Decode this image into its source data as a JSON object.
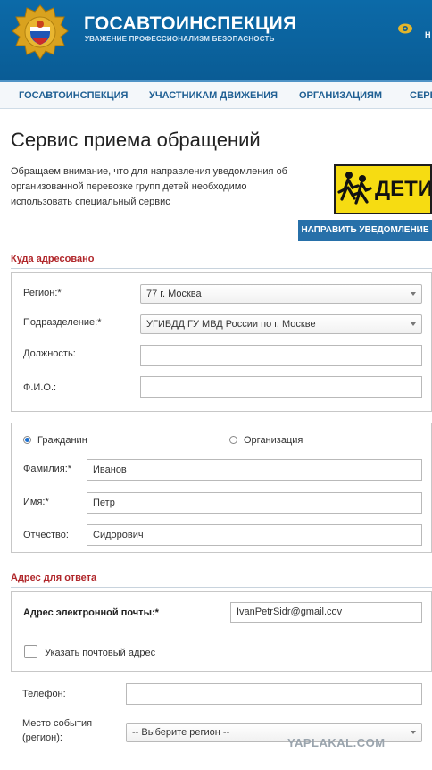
{
  "header": {
    "title": "ГОСАВТОИНСПЕКЦИЯ",
    "subtitle": "УВАЖЕНИЕ ПРОФЕССИОНАЛИЗМ БЕЗОПАСНОСТЬ",
    "cut_text": "Н"
  },
  "nav": {
    "items": [
      "ГОСАВТОИНСПЕКЦИЯ",
      "УЧАСТНИКАМ ДВИЖЕНИЯ",
      "ОРГАНИЗАЦИЯМ",
      "СЕРВ"
    ]
  },
  "page": {
    "title": "Сервис приема обращений",
    "notice": "Обращаем внимание, что для направления уведомления об организованной перевозке групп детей необходимо использовать специальный сервис",
    "banner_text": "ДЕТИ",
    "send_button": "НАПРАВИТЬ УВЕДОМЛЕНИЕ"
  },
  "addressed": {
    "title": "Куда адресовано",
    "region_label": "Регион:*",
    "region_value": "77 г. Москва",
    "division_label": "Подразделение:*",
    "division_value": "УГИБДД ГУ МВД России по г. Москве",
    "position_label": "Должность:",
    "position_value": "",
    "fio_label": "Ф.И.О.:",
    "fio_value": ""
  },
  "sender": {
    "type_citizen": "Гражданин",
    "type_org": "Организация",
    "surname_label": "Фамилия:*",
    "surname_value": "Иванов",
    "name_label": "Имя:*",
    "name_value": "Петр",
    "patronymic_label": "Отчество:",
    "patronymic_value": "Сидорович"
  },
  "reply": {
    "title": "Адрес для ответа",
    "email_label": "Адрес электронной почты:*",
    "email_value": "IvanPetrSidr@gmail.cov",
    "postal_label": "Указать почтовый адрес"
  },
  "extra": {
    "phone_label": "Телефон:",
    "phone_value": "",
    "event_label_1": "Место события",
    "event_label_2": "(регион):",
    "event_select": "-- Выберите регион --"
  },
  "watermark": "YAPLAKAL.COM",
  "colors": {
    "header": "#0a5c95",
    "accent": "#2770a9",
    "section_title": "#b0262a",
    "banner": "#f6dc12"
  }
}
